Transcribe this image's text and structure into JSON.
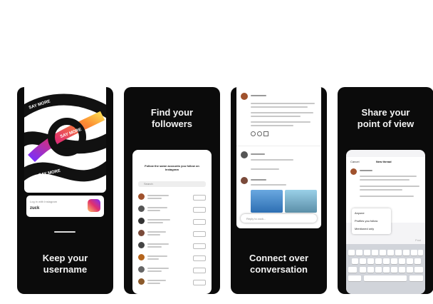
{
  "cards": [
    {
      "caption": "Keep your\nusername",
      "profile_card": {
        "label": "Log in with Instagram",
        "username": "zuck"
      },
      "art_words": [
        "SAY MORE",
        "SAY MORE",
        "SAY MORE"
      ]
    },
    {
      "caption": "Find your\nfollowers",
      "screen_title": "Follow the same accounts you follow on Instagram",
      "search_placeholder": "Search",
      "follow_label": "Follow"
    },
    {
      "caption": "Connect over\nconversation",
      "reply_placeholder": "Reply to zuck..."
    },
    {
      "caption": "Share your\npoint of view",
      "cancel_label": "Cancel",
      "header_title": "New thread",
      "audience_options": [
        "Anyone",
        "Profiles you follow",
        "Mentioned only"
      ],
      "post_label": "Post"
    }
  ],
  "colors": {
    "card_bg": "#0b0b0b",
    "accent": "#e1306c"
  }
}
